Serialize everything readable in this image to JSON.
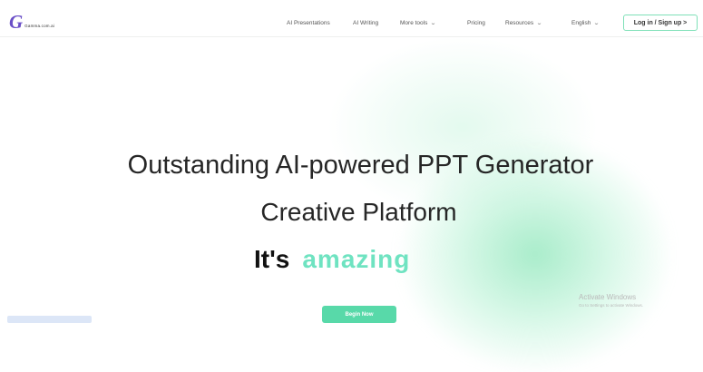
{
  "header": {
    "logo_mark": "G",
    "logo_text": "Gamma.com.ai",
    "login_label": "Log in / Sign up >"
  },
  "nav": {
    "items": [
      {
        "label": "AI Presentations",
        "has_dropdown": false
      },
      {
        "label": "AI Writing",
        "has_dropdown": false
      },
      {
        "label": "More tools",
        "has_dropdown": true
      },
      {
        "label": "Pricing",
        "has_dropdown": false
      },
      {
        "label": "Resources",
        "has_dropdown": true
      },
      {
        "label": "English",
        "has_dropdown": true
      }
    ],
    "dropdown_icon": "chevron-down-icon"
  },
  "hero": {
    "headline_1": "Outstanding AI-powered PPT Generator",
    "headline_2": "Creative Platform",
    "its": "It's",
    "amazing": "amazing",
    "cta_label": "Begin Now"
  },
  "watermark": {
    "line1": "Activate Windows",
    "line2": "Go to Settings to activate Windows."
  },
  "colors": {
    "brand_purple": "#6a4fc7",
    "accent_green": "#58d9a9",
    "highlight_teal": "#6fe3c1",
    "login_border": "#7fe0b8"
  }
}
